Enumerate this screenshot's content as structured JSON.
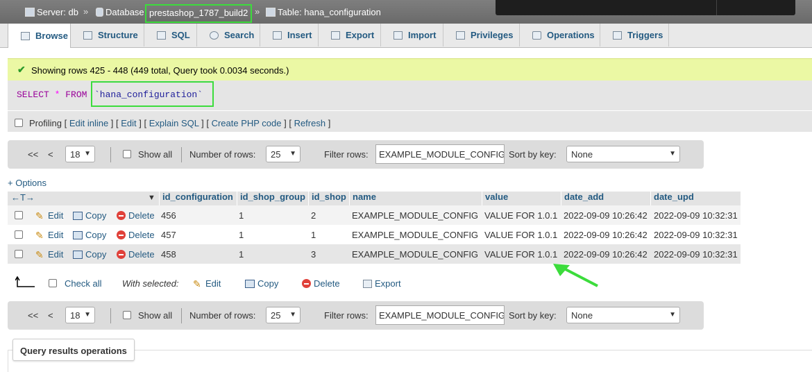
{
  "breadcrumb": {
    "server": "Server: db",
    "database_label": "Database",
    "database": "prestashop_1787_build2",
    "table": "Table: hana_configuration",
    "separator": "»"
  },
  "tabs": [
    "Browse",
    "Structure",
    "SQL",
    "Search",
    "Insert",
    "Export",
    "Import",
    "Privileges",
    "Operations",
    "Triggers"
  ],
  "message": "Showing rows 425 - 448 (449 total, Query took 0.0034 seconds.)",
  "sql": {
    "select": "SELECT",
    "star": "*",
    "from": "FROM",
    "table": "`hana_configuration`"
  },
  "profiling": {
    "label": "Profiling",
    "links": [
      "Edit inline",
      "Edit",
      "Explain SQL",
      "Create PHP code",
      "Refresh"
    ]
  },
  "nav": {
    "first": "<<",
    "prev": "<",
    "page": "18",
    "show_all": "Show all",
    "rows_label": "Number of rows:",
    "rows": "25",
    "filter_label": "Filter rows:",
    "filter_value": "EXAMPLE_MODULE_CONFIG",
    "sort_label": "Sort by key:",
    "sort_value": "None"
  },
  "options": "+ Options",
  "columns": [
    "id_configuration",
    "id_shop_group",
    "id_shop",
    "name",
    "value",
    "date_add",
    "date_upd"
  ],
  "row_actions": {
    "edit": "Edit",
    "copy": "Copy",
    "delete": "Delete"
  },
  "rows": [
    {
      "id_configuration": "456",
      "id_shop_group": "1",
      "id_shop": "2",
      "name": "EXAMPLE_MODULE_CONFIG",
      "value": "VALUE FOR 1.0.1",
      "date_add": "2022-09-09 10:26:42",
      "date_upd": "2022-09-09 10:32:31"
    },
    {
      "id_configuration": "457",
      "id_shop_group": "1",
      "id_shop": "1",
      "name": "EXAMPLE_MODULE_CONFIG",
      "value": "VALUE FOR 1.0.1",
      "date_add": "2022-09-09 10:26:42",
      "date_upd": "2022-09-09 10:32:31"
    },
    {
      "id_configuration": "458",
      "id_shop_group": "1",
      "id_shop": "3",
      "name": "EXAMPLE_MODULE_CONFIG",
      "value": "VALUE FOR 1.0.1",
      "date_add": "2022-09-09 10:26:42",
      "date_upd": "2022-09-09 10:32:31"
    }
  ],
  "bulk": {
    "check_all": "Check all",
    "with_selected": "With selected:",
    "edit": "Edit",
    "copy": "Copy",
    "delete": "Delete",
    "export": "Export"
  },
  "query_results_operations": "Query results operations",
  "colors": {
    "highlight": "#3cdc3c",
    "link": "#235a81",
    "success_bg": "#ebf8a4"
  }
}
